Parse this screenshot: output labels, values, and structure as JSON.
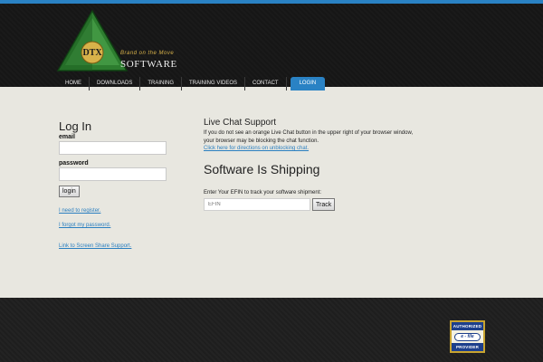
{
  "header": {
    "logo": {
      "monogram": "DTX",
      "tagline": "Brand on the Move",
      "wordmark": "SOFTWARE"
    },
    "nav": [
      {
        "label": "HOME"
      },
      {
        "label": "DOWNLOADS"
      },
      {
        "label": "TRAINING"
      },
      {
        "label": "TRAINING VIDEOS"
      },
      {
        "label": "CONTACT"
      },
      {
        "label": "LOGIN",
        "active": true
      }
    ]
  },
  "login": {
    "title": "Log In",
    "email_label": "email",
    "email_value": "",
    "password_label": "password",
    "password_value": "",
    "submit_label": "login",
    "register_link": "I need to register.",
    "forgot_link": "I forgot my password.",
    "screenshare_link": "Link to Screen Share Support."
  },
  "chat": {
    "title": "Live Chat Support",
    "body": "If you do not see an orange Live Chat button in the upper right of your browser window, your browser may be blocking the chat function.",
    "link": "Click here for directions on unblocking chat."
  },
  "shipping": {
    "title": "Software Is Shipping",
    "instruction": "Enter Your EFIN to track your software shipment:",
    "efin_placeholder": "EFIN",
    "track_label": "Track"
  },
  "footer": {
    "badge": {
      "top": "AUTHORIZED",
      "middle": "e - file",
      "bottom": "PROVIDER"
    }
  },
  "colors": {
    "accent": "#2a82c4",
    "link": "#2a7fc0",
    "header_bg": "#1a1a1a",
    "content_bg": "#e8e7e0"
  }
}
